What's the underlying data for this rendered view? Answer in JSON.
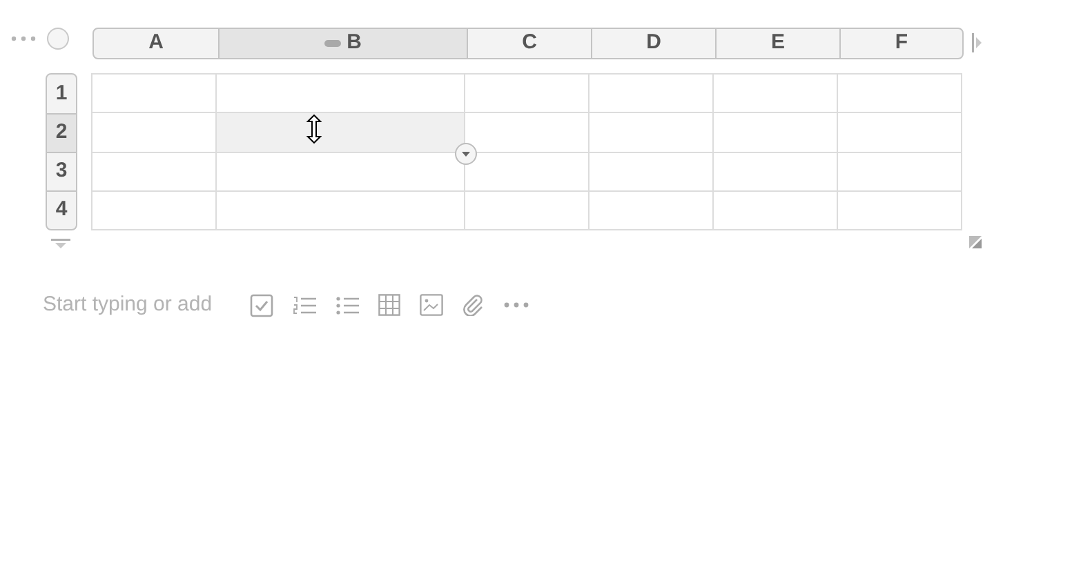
{
  "columns": [
    {
      "label": "A",
      "selected": false
    },
    {
      "label": "B",
      "selected": true
    },
    {
      "label": "C",
      "selected": false
    },
    {
      "label": "D",
      "selected": false
    },
    {
      "label": "E",
      "selected": false
    },
    {
      "label": "F",
      "selected": false
    }
  ],
  "rows": [
    {
      "label": "1",
      "selected": false
    },
    {
      "label": "2",
      "selected": true
    },
    {
      "label": "3",
      "selected": false
    },
    {
      "label": "4",
      "selected": false
    }
  ],
  "editor": {
    "placeholder": "Start typing or add"
  }
}
